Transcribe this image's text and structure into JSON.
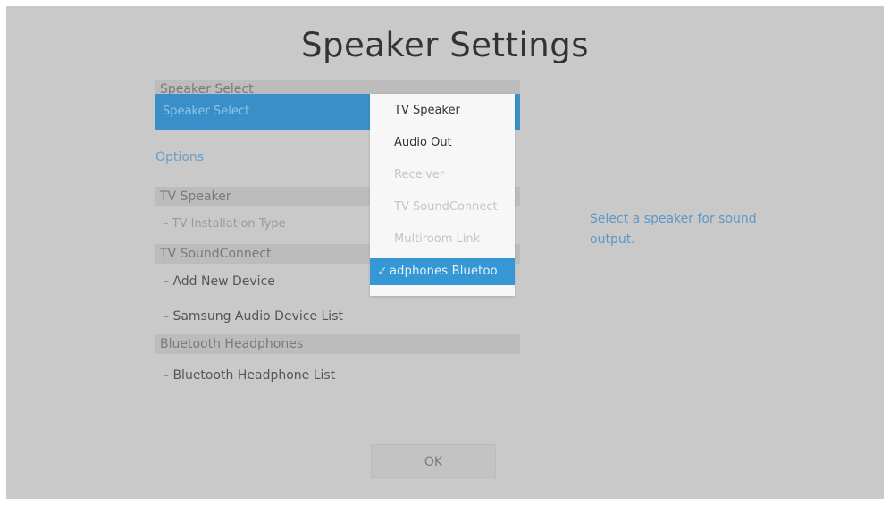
{
  "title": "Speaker Settings",
  "speaker_select": {
    "header": "Speaker Select",
    "selected_value": "Speaker Select"
  },
  "options": {
    "label": "Options",
    "tv_speaker": {
      "header": "TV Speaker",
      "items": [
        "TV Installation Type"
      ]
    },
    "tv_soundconnect": {
      "header": "TV SoundConnect",
      "items": [
        "Add New Device",
        "Samsung Audio Device List"
      ]
    },
    "bluetooth_headphones": {
      "header": "Bluetooth Headphones",
      "items": [
        "Bluetooth Headphone List"
      ]
    }
  },
  "dropdown": {
    "items": [
      {
        "label": "TV Speaker",
        "state": "enabled"
      },
      {
        "label": "Audio Out",
        "state": "enabled"
      },
      {
        "label": "Receiver",
        "state": "disabled"
      },
      {
        "label": "TV SoundConnect",
        "state": "disabled"
      },
      {
        "label": "Multiroom Link",
        "state": "disabled"
      },
      {
        "label": "adphones Bluetoo",
        "state": "selected"
      }
    ],
    "check_glyph": "✓"
  },
  "help_text": "Select a speaker for sound output.",
  "ok_button": "OK",
  "icons": {
    "dropdown_arrow": "chevron-down-icon",
    "check": "check-icon"
  },
  "colors": {
    "accent": "#3597d3",
    "background": "#c9c9c9",
    "help_text": "#5e97c8"
  }
}
